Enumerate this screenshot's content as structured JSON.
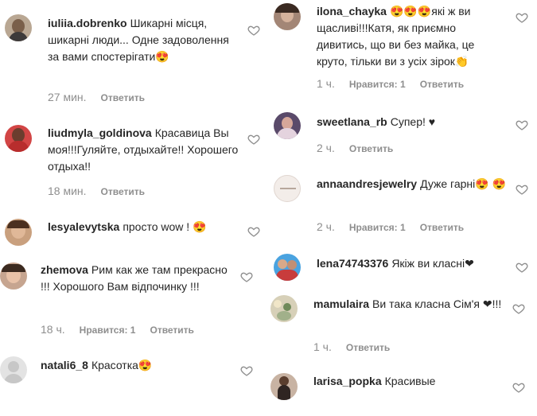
{
  "left": [
    {
      "user": "iuliia.dobrenko",
      "text": "Шикарні місця, шикарні люди... Одне задоволення за вами спостерігати😍",
      "time": "27 мин.",
      "likes": "",
      "reply": "Ответить"
    },
    {
      "user": "liudmyla_goldinova",
      "text": "Красавица Вы моя!!!Гуляйте, отдыхайте!! Хорошего отдыха!!",
      "time": "18 мин.",
      "likes": "",
      "reply": "Ответить"
    },
    {
      "user": "lesyalevytska",
      "text": "просто wow ! 😍",
      "time": "",
      "likes": "",
      "reply": ""
    },
    {
      "user": "zhemova",
      "text": "Рим как же там прекрасно !!! Хорошого Вам відпочинку !!!",
      "time": "18 ч.",
      "likes": "Нравится: 1",
      "reply": "Ответить"
    },
    {
      "user": "natali6_8",
      "text": "Красотка😍",
      "time": "",
      "likes": "",
      "reply": ""
    }
  ],
  "right": [
    {
      "user": "ilona_chayka",
      "text": "😍😍😍які ж ви щасливі!!!Катя, як приємно дивитись, що ви без майка, це круто, тільки ви з усіх зірок👏",
      "time": "1 ч.",
      "likes": "Нравится: 1",
      "reply": "Ответить"
    },
    {
      "user": "sweetlana_rb",
      "text": "Супер! ♥",
      "time": "2 ч.",
      "likes": "",
      "reply": "Ответить"
    },
    {
      "user": "annaandresjewelry",
      "text": "Дуже гарні😍 😍",
      "time": "2 ч.",
      "likes": "Нравится: 1",
      "reply": "Ответить"
    },
    {
      "user": "lena74743376",
      "text": "Якіж ви класні❤",
      "time": "",
      "likes": "",
      "reply": ""
    },
    {
      "user": "mamulaira",
      "text": "Ви така класна Сім'я ❤!!!",
      "time": "1 ч.",
      "likes": "",
      "reply": "Ответить"
    },
    {
      "user": "larisa_popka",
      "text": "Красивые",
      "time": "",
      "likes": "",
      "reply": ""
    }
  ],
  "colors": {
    "text": "#262626",
    "muted": "#8e8e8e",
    "heart_stroke": "#8e8e8e"
  },
  "icons": {
    "like": "heart-outline-icon"
  }
}
